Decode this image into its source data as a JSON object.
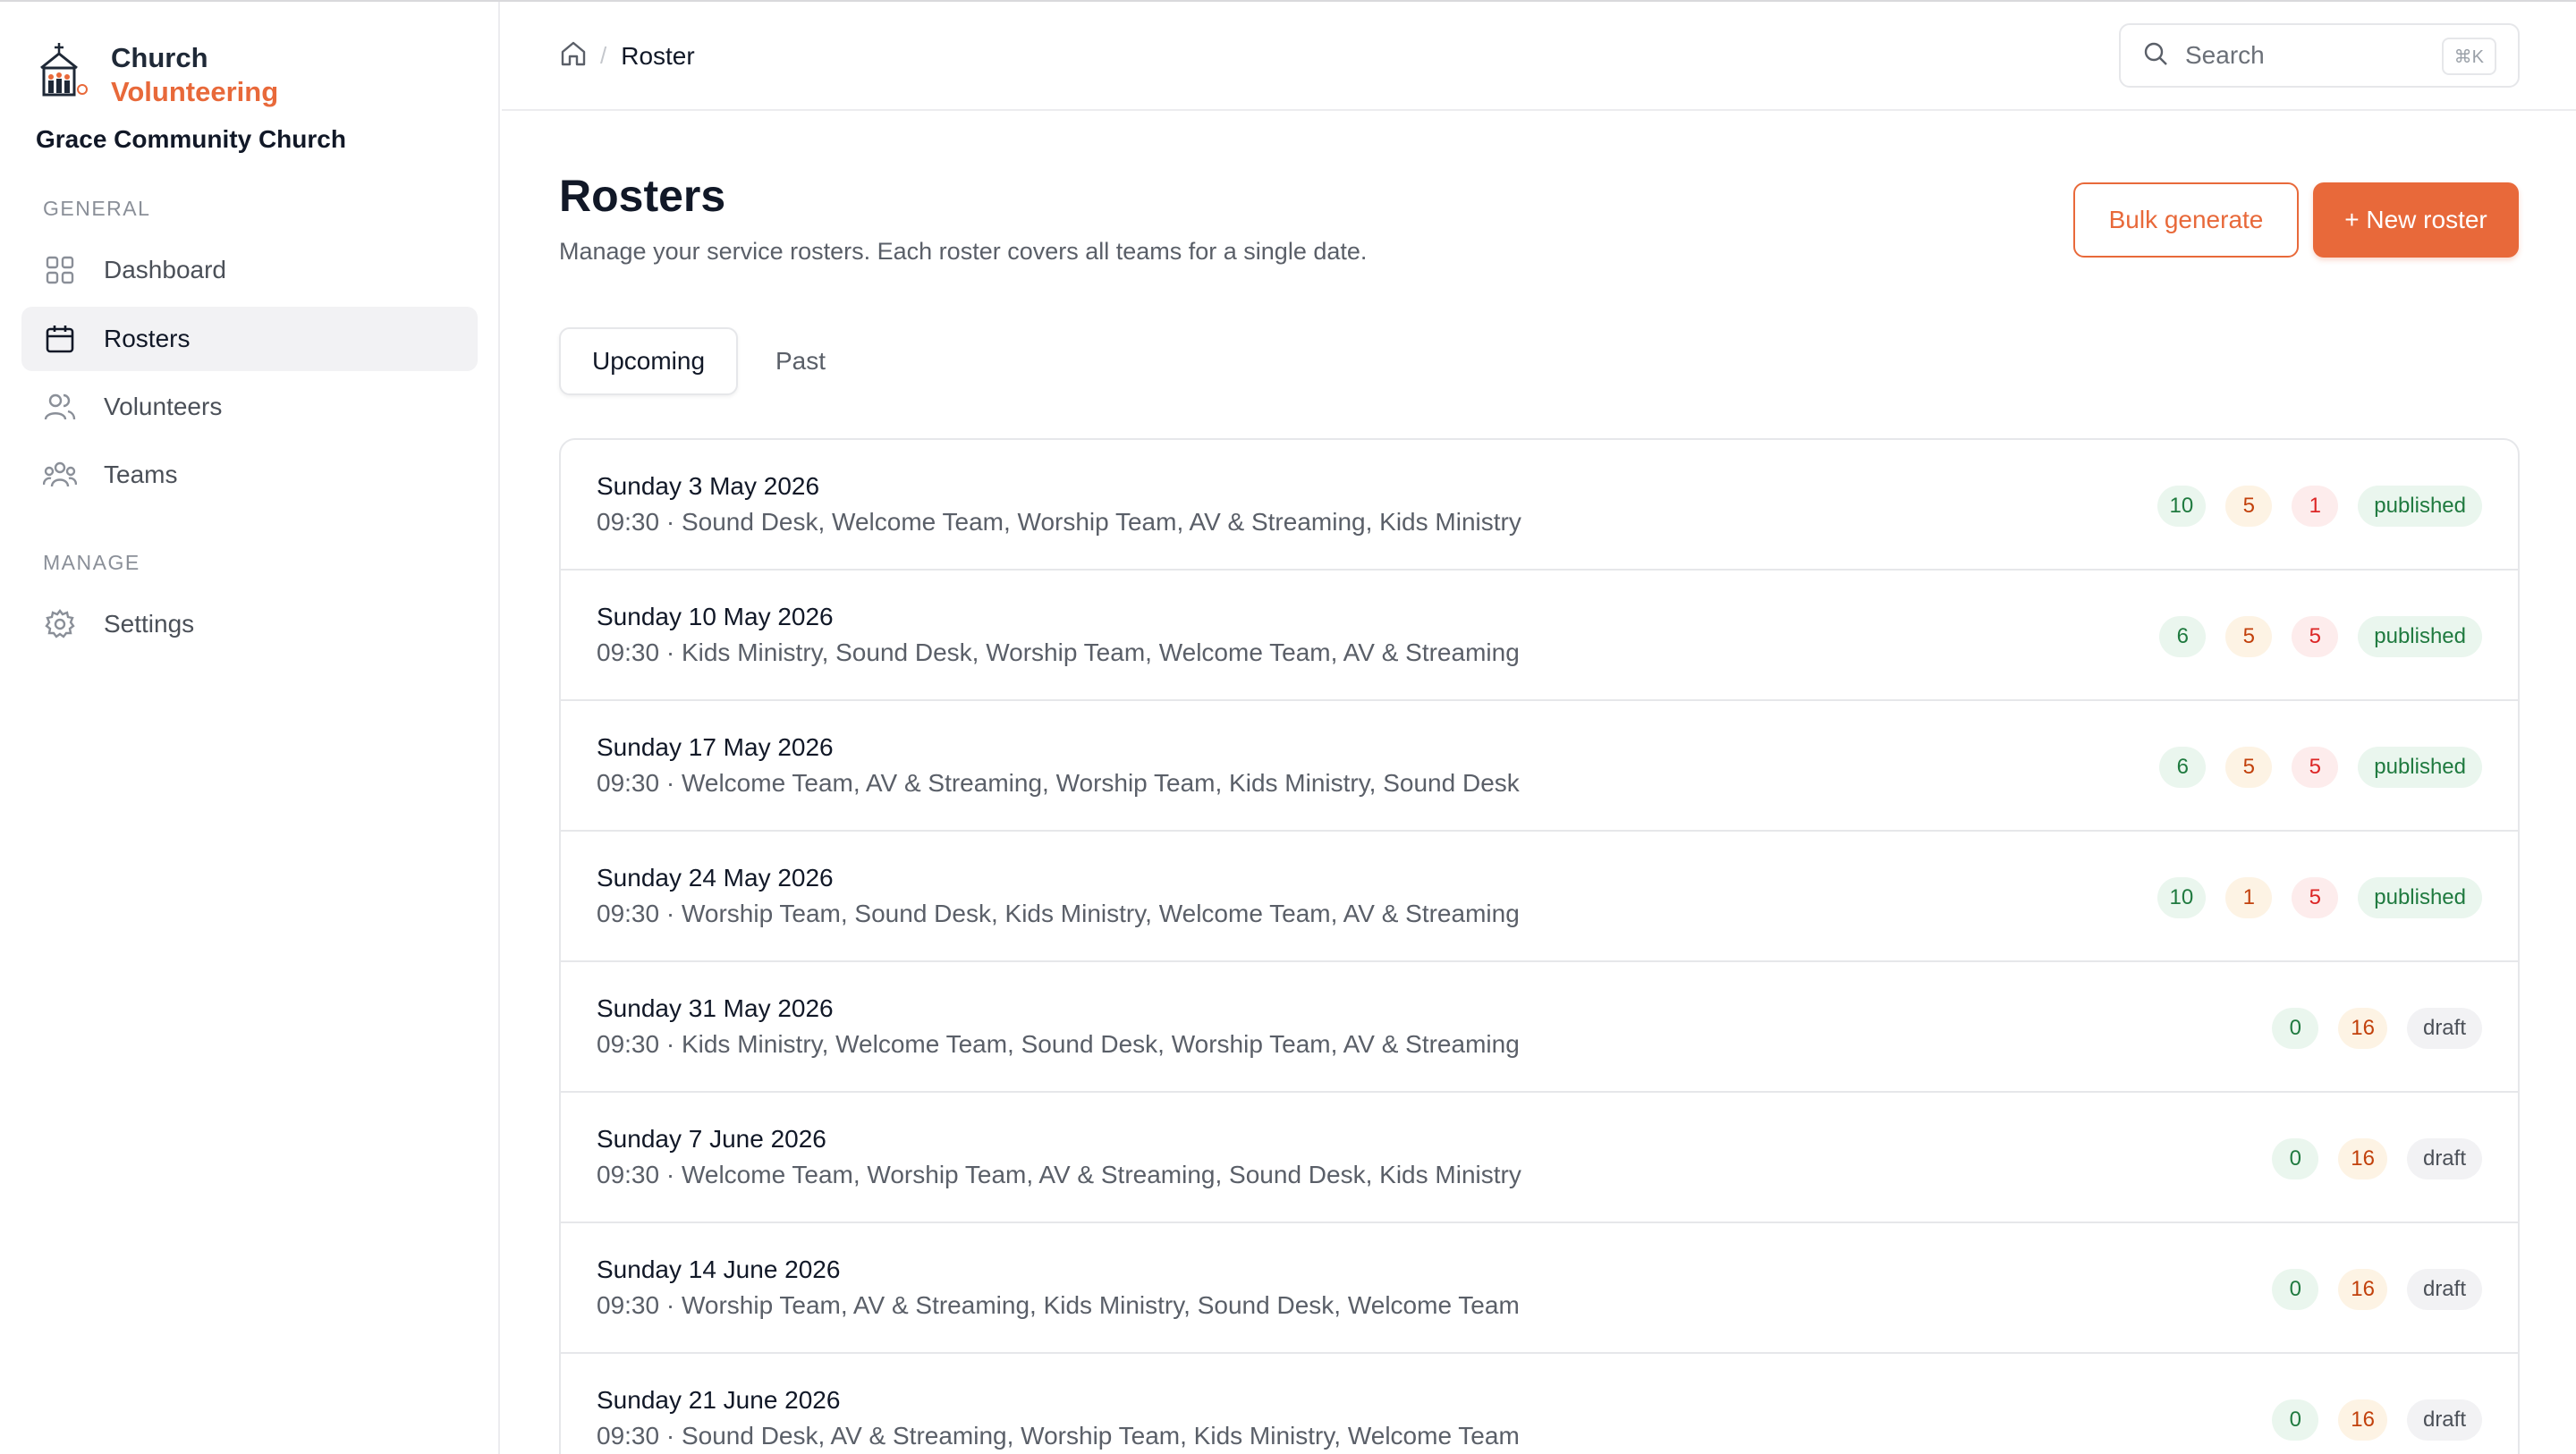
{
  "brand": {
    "line1": "Church",
    "line2": "Volunteering",
    "org": "Grace Community Church",
    "accent": "#e8693a"
  },
  "sidebar": {
    "general_label": "GENERAL",
    "manage_label": "MANAGE",
    "items": [
      {
        "label": "Dashboard",
        "icon": "grid-icon"
      },
      {
        "label": "Rosters",
        "icon": "calendar-icon",
        "active": true
      },
      {
        "label": "Volunteers",
        "icon": "users-icon"
      },
      {
        "label": "Teams",
        "icon": "team-icon"
      }
    ],
    "manage_items": [
      {
        "label": "Settings",
        "icon": "gear-icon"
      }
    ]
  },
  "header": {
    "breadcrumb_current": "Roster",
    "search_placeholder": "Search",
    "search_shortcut": "⌘K"
  },
  "main": {
    "title": "Rosters",
    "subtitle": "Manage your service rosters. Each roster covers all teams for a single date.",
    "bulk_label": "Bulk generate",
    "new_label": "+ New roster",
    "tabs": [
      {
        "label": "Upcoming",
        "active": true
      },
      {
        "label": "Past",
        "active": false
      }
    ]
  },
  "rosters": [
    {
      "date": "Sunday 3 May 2026",
      "details": "09:30 · Sound Desk, Welcome Team, Worship Team, AV & Streaming, Kids Ministry",
      "counts": [
        "10",
        "5",
        "1"
      ],
      "status": "published"
    },
    {
      "date": "Sunday 10 May 2026",
      "details": "09:30 · Kids Ministry, Sound Desk, Worship Team, Welcome Team, AV & Streaming",
      "counts": [
        "6",
        "5",
        "5"
      ],
      "status": "published"
    },
    {
      "date": "Sunday 17 May 2026",
      "details": "09:30 · Welcome Team, AV & Streaming, Worship Team, Kids Ministry, Sound Desk",
      "counts": [
        "6",
        "5",
        "5"
      ],
      "status": "published"
    },
    {
      "date": "Sunday 24 May 2026",
      "details": "09:30 · Worship Team, Sound Desk, Kids Ministry, Welcome Team, AV & Streaming",
      "counts": [
        "10",
        "1",
        "5"
      ],
      "status": "published"
    },
    {
      "date": "Sunday 31 May 2026",
      "details": "09:30 · Kids Ministry, Welcome Team, Sound Desk, Worship Team, AV & Streaming",
      "counts": [
        "0",
        "16"
      ],
      "status": "draft"
    },
    {
      "date": "Sunday 7 June 2026",
      "details": "09:30 · Welcome Team, Worship Team, AV & Streaming, Sound Desk, Kids Ministry",
      "counts": [
        "0",
        "16"
      ],
      "status": "draft"
    },
    {
      "date": "Sunday 14 June 2026",
      "details": "09:30 · Worship Team, AV & Streaming, Kids Ministry, Sound Desk, Welcome Team",
      "counts": [
        "0",
        "16"
      ],
      "status": "draft"
    },
    {
      "date": "Sunday 21 June 2026",
      "details": "09:30 · Sound Desk, AV & Streaming, Worship Team, Kids Ministry, Welcome Team",
      "counts": [
        "0",
        "16"
      ],
      "status": "draft"
    }
  ]
}
